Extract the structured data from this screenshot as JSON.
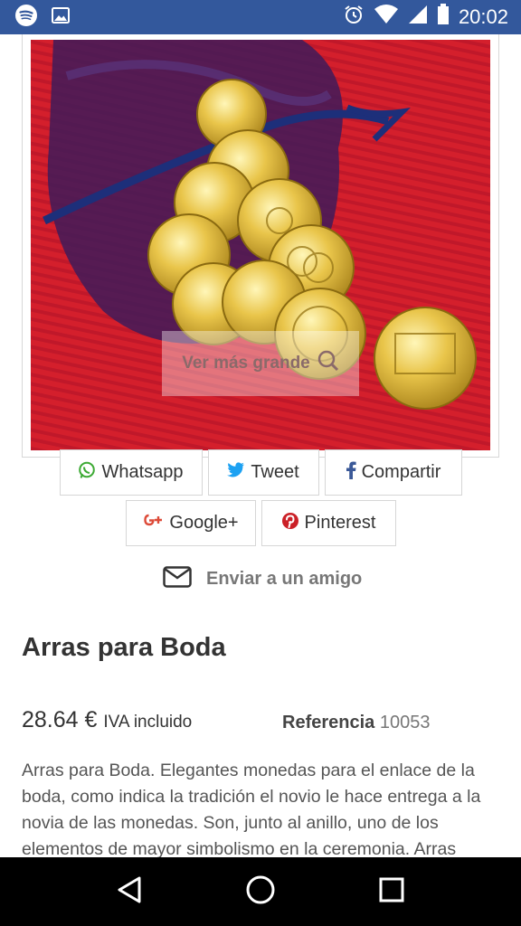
{
  "status_bar": {
    "time": "20:02",
    "icons": [
      "spotify-icon",
      "image-icon",
      "alarm-icon",
      "wifi-icon",
      "signal-icon",
      "battery-icon"
    ],
    "color": "#33589c"
  },
  "product_image": {
    "enlarge_label": "Ver más grande"
  },
  "share": {
    "whatsapp": "Whatsapp",
    "tweet": "Tweet",
    "compartir": "Compartir",
    "googleplus": "Google+",
    "pinterest": "Pinterest",
    "colors": {
      "whatsapp": "#3daa34",
      "twitter": "#1da1f2",
      "facebook": "#3b5998",
      "googleplus": "#dd4b39",
      "pinterest": "#cb2027"
    }
  },
  "send_friend": {
    "label": "Enviar a un amigo"
  },
  "product": {
    "title": "Arras para Boda",
    "price": "28.64 €",
    "tax_note": "IVA incluido",
    "reference_label": "Referencia",
    "reference_value": "10053",
    "description": "Arras para Boda. Elegantes monedas para el enlace de la boda, como indica la tradición el novio le hace entrega a la novia de las monedas. Son, junto al anillo, uno de los elementos de mayor simbolismo en la ceremonia. Arras"
  },
  "nav_bar": {
    "icons": [
      "back-icon",
      "home-icon",
      "recents-icon"
    ]
  }
}
